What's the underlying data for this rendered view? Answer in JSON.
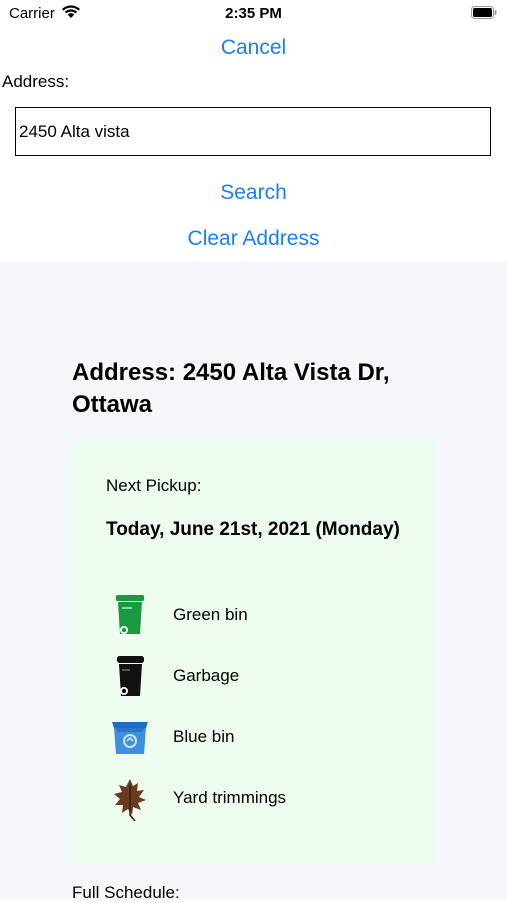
{
  "status_bar": {
    "carrier": "Carrier",
    "time": "2:35 PM"
  },
  "form": {
    "cancel_label": "Cancel",
    "address_label": "Address:",
    "address_value": "2450 Alta vista",
    "search_label": "Search",
    "clear_label": "Clear Address"
  },
  "result": {
    "address_title": "Address: 2450 Alta Vista Dr, Ottawa",
    "next_pickup_label": "Next Pickup:",
    "pickup_date": "Today, June 21st, 2021 (Monday)",
    "items": [
      {
        "label": "Green bin",
        "icon": "green-bin-icon",
        "color": "#1a9a3e"
      },
      {
        "label": "Garbage",
        "icon": "garbage-bin-icon",
        "color": "#111111"
      },
      {
        "label": "Blue bin",
        "icon": "blue-bin-icon",
        "color": "#2f7fd0"
      },
      {
        "label": "Yard trimmings",
        "icon": "leaf-icon",
        "color": "#6b3b1e"
      }
    ],
    "full_schedule_label": "Full Schedule:"
  },
  "colors": {
    "link": "#1b7ff2",
    "results_bg": "#f6f7fb",
    "card_bg": "#eefcef"
  }
}
